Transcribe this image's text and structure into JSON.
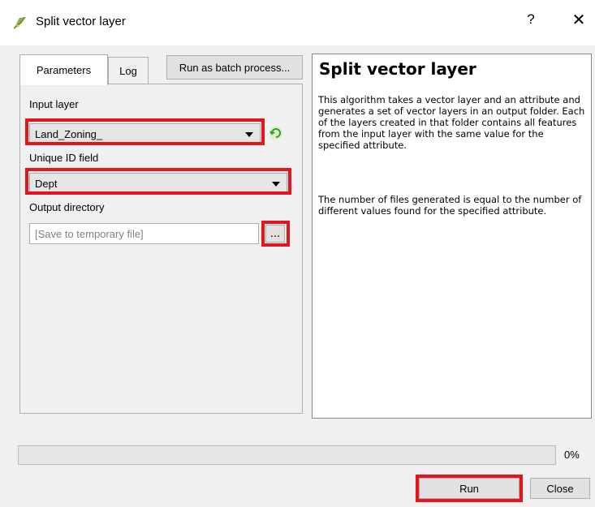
{
  "window": {
    "title": "Split vector layer",
    "help_glyph": "?",
    "close_glyph": "✕",
    "icon": "qgis-icon"
  },
  "tabs": [
    {
      "label": "Parameters",
      "active": true
    },
    {
      "label": "Log",
      "active": false
    }
  ],
  "batch_button_label": "Run as batch process...",
  "params": {
    "input_layer_label": "Input layer",
    "input_layer_value": "Land_Zoning_",
    "unique_id_label": "Unique ID field",
    "unique_id_value": "Dept",
    "output_dir_label": "Output directory",
    "output_dir_value": "",
    "output_dir_placeholder": "[Save to temporary file]",
    "browse_label": "..."
  },
  "help": {
    "title": "Split vector layer",
    "paragraph1": "This algorithm takes a vector layer and an attribute and generates a set of vector layers in an output folder. Each of the layers created in that folder contains all features from the input layer with the same value for the specified attribute.",
    "paragraph2": "The number of files generated is equal to the number of different values found for the specified attribute."
  },
  "progress": {
    "value": 0,
    "label": "0%"
  },
  "buttons": {
    "run_label": "Run",
    "close_label": "Close"
  },
  "colors": {
    "highlight": "#e3151e",
    "window_bg": "#f0f0f0"
  }
}
